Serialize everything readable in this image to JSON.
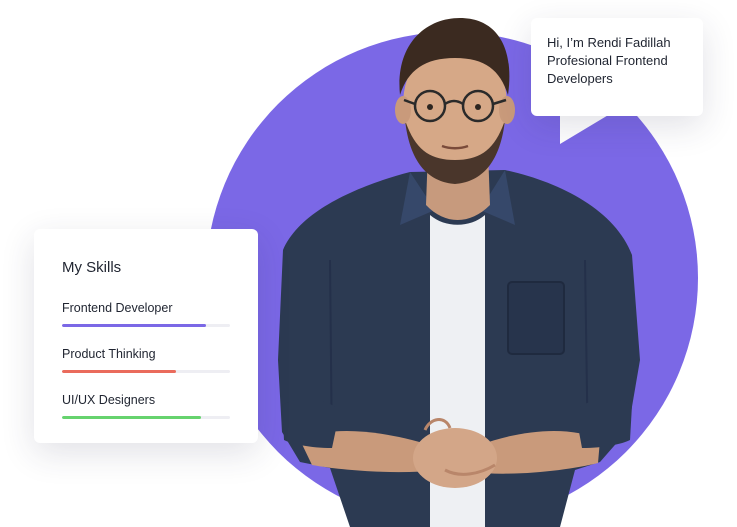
{
  "speech_bubble": {
    "lines": [
      "Hi, I’m Rendi Fadillah",
      "Profesional Frontend",
      "Developers"
    ]
  },
  "skills_card": {
    "title": "My Skills",
    "skills": [
      {
        "label": "Frontend Developer",
        "level": 0.86,
        "color": "#7b68e6"
      },
      {
        "label": "Product Thinking",
        "level": 0.68,
        "color": "#ea6b5c"
      },
      {
        "label": "UI/UX Designers",
        "level": 0.83,
        "color": "#66d36e"
      }
    ]
  },
  "colors": {
    "accent_purple": "#7b68e6",
    "shirt": "#2c3a52",
    "background": "#ffffff"
  },
  "portrait": {
    "icon": "person-portrait-illustration"
  }
}
